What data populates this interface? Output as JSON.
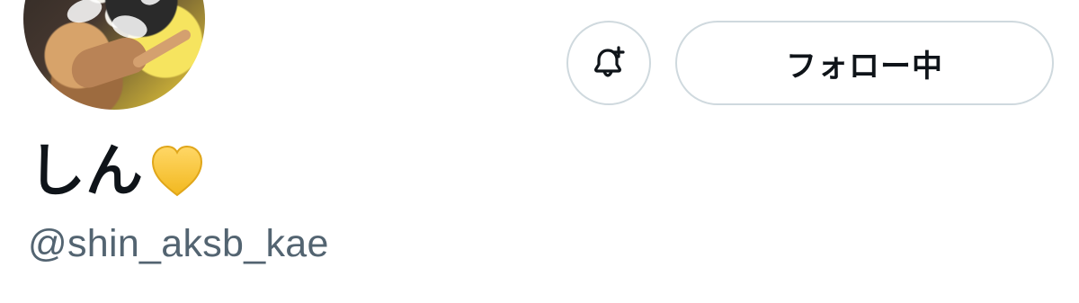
{
  "profile": {
    "display_name": "しん",
    "handle": "@shin_aksb_kae",
    "name_emoji_icon": "yellow-heart-icon"
  },
  "actions": {
    "follow_label": "フォロー中",
    "notify_icon": "bell-plus-icon"
  },
  "colors": {
    "border": "#cfd9de",
    "text_primary": "#0f1419",
    "text_secondary": "#536471",
    "heart_fill": "#f7c744"
  }
}
